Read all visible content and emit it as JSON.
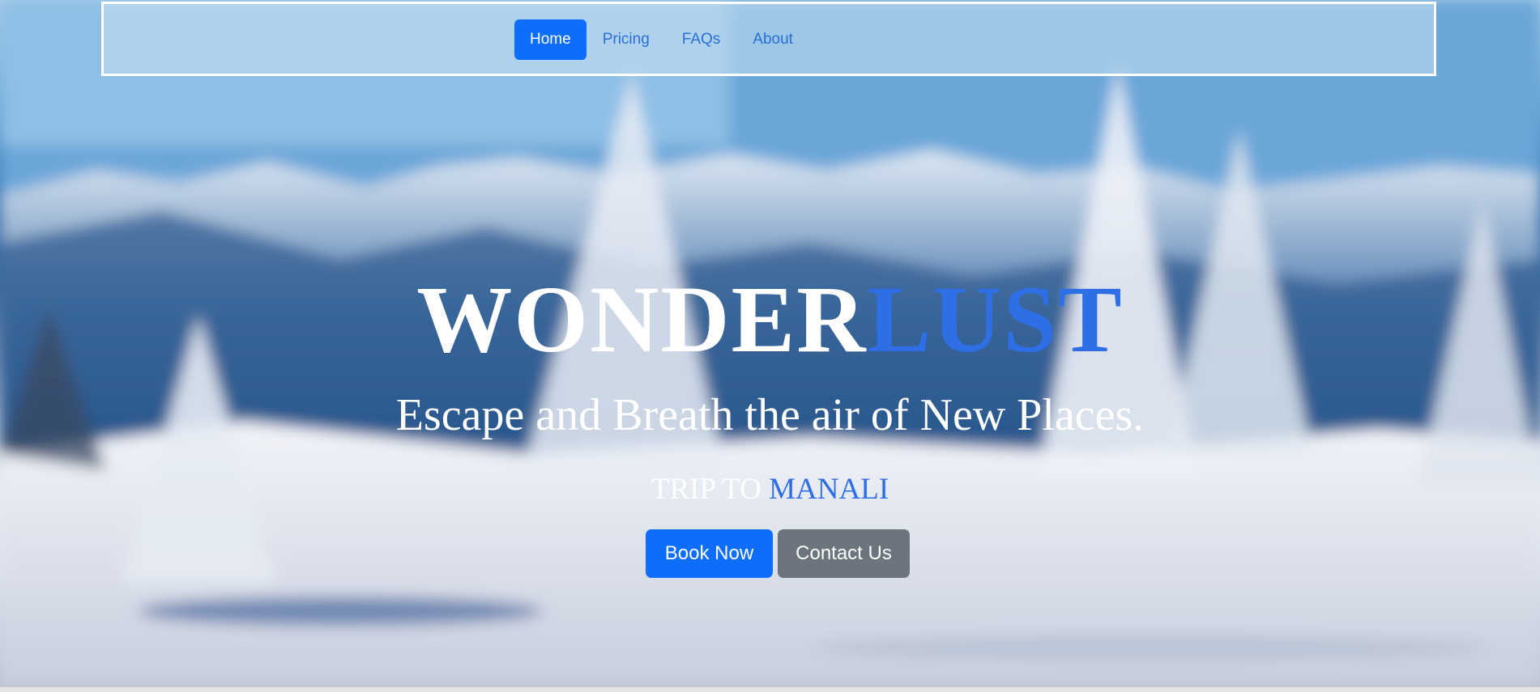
{
  "nav": {
    "items": [
      {
        "label": "Home",
        "active": true
      },
      {
        "label": "Pricing",
        "active": false
      },
      {
        "label": "FAQs",
        "active": false
      },
      {
        "label": "About",
        "active": false
      }
    ]
  },
  "hero": {
    "title_main": "WONDER",
    "title_accent": "LUST",
    "subtitle": "Escape and Breath the air of New Places.",
    "trip_prefix": "TRIP TO ",
    "trip_destination": "MANALI"
  },
  "actions": {
    "book_label": "Book Now",
    "contact_label": "Contact Us"
  },
  "colors": {
    "primary": "#0d6efd",
    "secondary": "#6c757d",
    "accent_text": "#2e6fe6",
    "nav_link": "#2a6fd6"
  }
}
